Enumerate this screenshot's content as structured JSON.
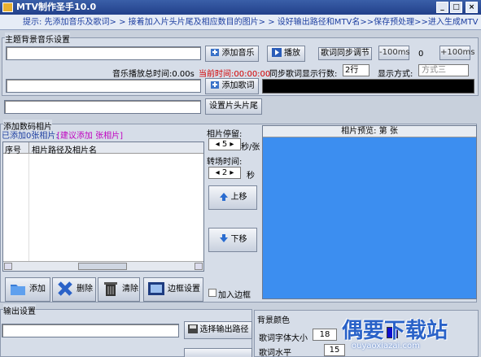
{
  "window": {
    "title": "MTV制作圣手10.0",
    "min_label": "_",
    "max_label": "□",
    "close_label": "×"
  },
  "hint": "提示: 先添加音乐及歌词> > 接着加入片头片尾及相应数目的图片> > 设好输出路径和MTV名>>保存预处理>>进入生成MTV",
  "music": {
    "group_label": "主题背景音乐设置",
    "add_music_label": "添加音乐",
    "play_label": "播放",
    "sync_label": "歌词同步调节",
    "minus_label": "-100ms",
    "offset_value": "0",
    "plus_label": "+100ms",
    "total_time_label": "音乐播放总时间:0.00s",
    "current_time_label": "当前时间:00:00:00",
    "add_lyrics_label": "添加歌词",
    "lines_label": "同步歌词显示行数:",
    "lines_value": "2行",
    "mode_label": "显示方式:",
    "mode_value": "方式三"
  },
  "header_tail": {
    "button_label": "设置片头片尾"
  },
  "photos": {
    "group_label": "添加数码相片",
    "count_text": "已添加0张相片:",
    "suggest_text": "[建议添加 张相片]",
    "col_index": "序号",
    "col_path": "相片路径及相片名",
    "stay_label": "相片停留:",
    "stay_value": "5",
    "stay_unit": "秒/张",
    "transition_label": "转场时间:",
    "transition_value": "2",
    "transition_unit": "秒",
    "up_label": "上移",
    "down_label": "下移",
    "preview_label": "相片预览: 第  张",
    "add_label": "添加",
    "delete_label": "删除",
    "clear_label": "清除",
    "frame_label": "边框设置",
    "add_frame_label": "加入边框"
  },
  "output": {
    "group_label": "输出设置",
    "select_path_label": "选择输出路径",
    "bg_color_label": "背景颜色",
    "font_size_label": "歌词字体大小",
    "font_size_value": "18",
    "lyric_h_label": "歌词水平",
    "lyric_h_value": "15"
  },
  "watermark": {
    "text": "偶要下载站",
    "sub": "ouyaoxiazai.com"
  },
  "colors": {
    "title_bg": "#22408a",
    "hint_text": "#1c3ea0",
    "preview_bg": "#3c8ef0",
    "panel_bg": "#d6dde8",
    "accent_red": "#d40000",
    "accent_magenta": "#c000c0"
  }
}
